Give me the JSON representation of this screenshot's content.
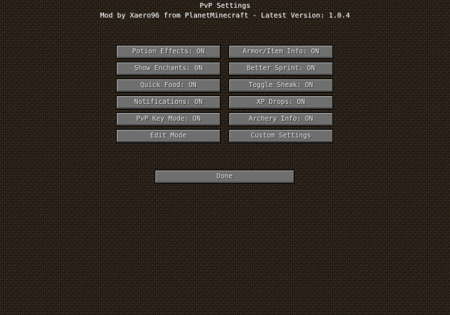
{
  "header": {
    "title": "PvP Settings",
    "subtitle": "Mod by Xaero96 from PlanetMinecraft - Latest Version: 1.0.4"
  },
  "buttons": {
    "potion_effects": "Potion Effects: ON",
    "armor_item_info": "Armor/Item Info: ON",
    "show_enchants": "Show Enchants: ON",
    "better_sprint": "Better Sprint: ON",
    "quick_food": "Quick Food: ON",
    "toggle_sneak": "Toggle Sneak: ON",
    "notifications": "Notifications: ON",
    "xp_drops": "XP Drops: ON",
    "pvp_key_mode": "PvP Key Mode: ON",
    "archery_info": "Archery Info: ON",
    "edit_mode": "Edit Mode",
    "custom_settings": "Custom Settings",
    "done": "Done"
  },
  "colors": {
    "background": "#2a2016",
    "button_fill": "#6f6f6f",
    "button_text": "#e0e0e0",
    "title_text": "#ffffff"
  }
}
